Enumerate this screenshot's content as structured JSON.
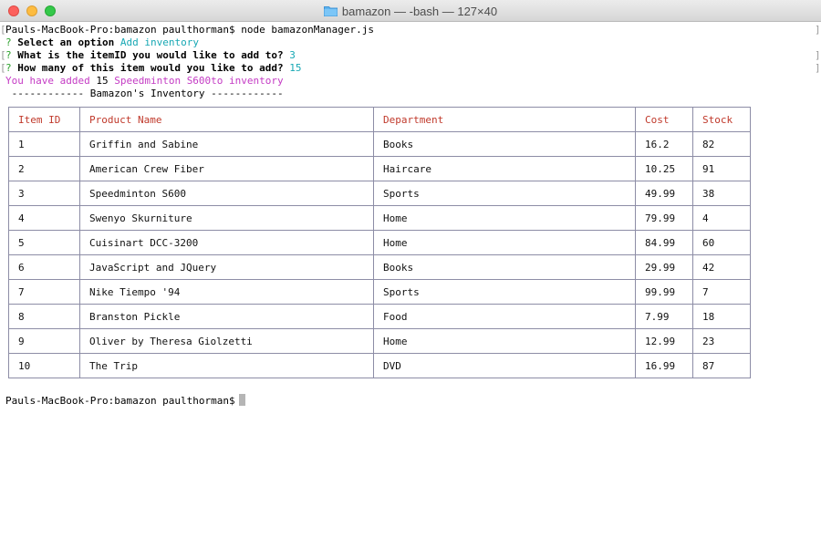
{
  "window": {
    "title": "bamazon — -bash — 127×40"
  },
  "terminal": {
    "command_line": {
      "prompt": "Pauls-MacBook-Pro:bamazon paulthorman$",
      "command": "node bamazonManager.js"
    },
    "q1": {
      "mark": "?",
      "question": "Select an option",
      "answer": "Add inventory"
    },
    "q2": {
      "mark": "?",
      "question": "What is the itemID you would like to add to?",
      "answer": "3"
    },
    "q3": {
      "mark": "?",
      "question": "How many of this item would you like to add?",
      "answer": "15"
    },
    "added": {
      "prefix": "You have added",
      "qty": "15",
      "suffix": "Speedminton S600to inventory"
    },
    "inventory_header": " ------------ Bamazon's Inventory ------------",
    "final_prompt": "Pauls-MacBook-Pro:bamazon paulthorman$"
  },
  "table": {
    "headers": [
      "Item ID",
      "Product Name",
      "Department",
      "Cost",
      "Stock"
    ],
    "rows": [
      [
        "1",
        "Griffin and Sabine",
        "Books",
        "16.2",
        "82"
      ],
      [
        "2",
        "American Crew Fiber",
        "Haircare",
        "10.25",
        "91"
      ],
      [
        "3",
        "Speedminton S600",
        "Sports",
        "49.99",
        "38"
      ],
      [
        "4",
        "Swenyo Skurniture",
        "Home",
        "79.99",
        "4"
      ],
      [
        "5",
        "Cuisinart DCC-3200",
        "Home",
        "84.99",
        "60"
      ],
      [
        "6",
        "JavaScript and JQuery",
        "Books",
        "29.99",
        "42"
      ],
      [
        "7",
        "Nike Tiempo '94",
        "Sports",
        "99.99",
        "7"
      ],
      [
        "8",
        "Branston Pickle",
        "Food",
        "7.99",
        "18"
      ],
      [
        "9",
        "Oliver by Theresa Giolzetti",
        "Home",
        "12.99",
        "23"
      ],
      [
        "10",
        "The Trip",
        "DVD",
        "16.99",
        "87"
      ]
    ]
  },
  "colors": {
    "header_text": "#c0392b",
    "answer": "#18a8b4",
    "question_mark": "#2ea12e",
    "added_text": "#c43bc4"
  },
  "icons": {
    "title_icon": "folder-icon"
  }
}
